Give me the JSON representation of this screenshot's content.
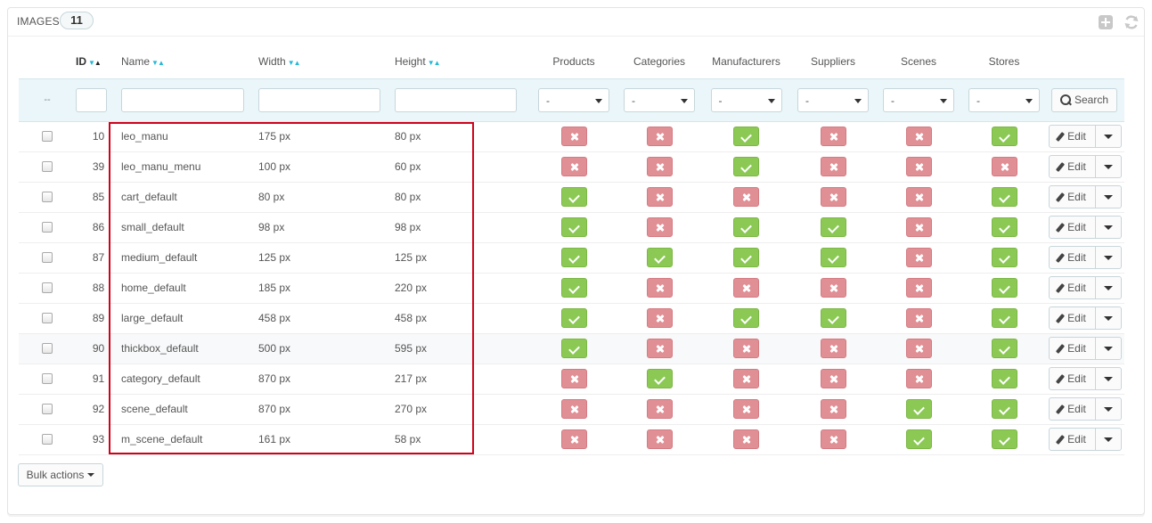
{
  "panel": {
    "title": "IMAGES",
    "count": "11",
    "tools": [
      "add-icon",
      "refresh-icon"
    ]
  },
  "columns": {
    "id": "ID",
    "name": "Name",
    "width": "Width",
    "height": "Height",
    "products": "Products",
    "categories": "Categories",
    "manufacturers": "Manufacturers",
    "suppliers": "Suppliers",
    "scenes": "Scenes",
    "stores": "Stores"
  },
  "filters": {
    "dashes": "--",
    "select_value": "-",
    "search_label": "Search"
  },
  "rows": [
    {
      "id": "10",
      "name": "leo_manu",
      "width": "175 px",
      "height": "80 px",
      "products": false,
      "categories": false,
      "manufacturers": true,
      "suppliers": false,
      "scenes": false,
      "stores": true
    },
    {
      "id": "39",
      "name": "leo_manu_menu",
      "width": "100 px",
      "height": "60 px",
      "products": false,
      "categories": false,
      "manufacturers": true,
      "suppliers": false,
      "scenes": false,
      "stores": false
    },
    {
      "id": "85",
      "name": "cart_default",
      "width": "80 px",
      "height": "80 px",
      "products": true,
      "categories": false,
      "manufacturers": false,
      "suppliers": false,
      "scenes": false,
      "stores": true
    },
    {
      "id": "86",
      "name": "small_default",
      "width": "98 px",
      "height": "98 px",
      "products": true,
      "categories": false,
      "manufacturers": true,
      "suppliers": true,
      "scenes": false,
      "stores": true
    },
    {
      "id": "87",
      "name": "medium_default",
      "width": "125 px",
      "height": "125 px",
      "products": true,
      "categories": true,
      "manufacturers": true,
      "suppliers": true,
      "scenes": false,
      "stores": true
    },
    {
      "id": "88",
      "name": "home_default",
      "width": "185 px",
      "height": "220 px",
      "products": true,
      "categories": false,
      "manufacturers": false,
      "suppliers": false,
      "scenes": false,
      "stores": true
    },
    {
      "id": "89",
      "name": "large_default",
      "width": "458 px",
      "height": "458 px",
      "products": true,
      "categories": false,
      "manufacturers": true,
      "suppliers": true,
      "scenes": false,
      "stores": true
    },
    {
      "id": "90",
      "name": "thickbox_default",
      "width": "500 px",
      "height": "595 px",
      "products": true,
      "categories": false,
      "manufacturers": false,
      "suppliers": false,
      "scenes": false,
      "stores": true
    },
    {
      "id": "91",
      "name": "category_default",
      "width": "870 px",
      "height": "217 px",
      "products": false,
      "categories": true,
      "manufacturers": false,
      "suppliers": false,
      "scenes": false,
      "stores": true
    },
    {
      "id": "92",
      "name": "scene_default",
      "width": "870 px",
      "height": "270 px",
      "products": false,
      "categories": false,
      "manufacturers": false,
      "suppliers": false,
      "scenes": true,
      "stores": true
    },
    {
      "id": "93",
      "name": "m_scene_default",
      "width": "161 px",
      "height": "58 px",
      "products": false,
      "categories": false,
      "manufacturers": false,
      "suppliers": false,
      "scenes": true,
      "stores": true
    }
  ],
  "row_actions": {
    "edit_label": "Edit",
    "edit_icon": "pencil-icon",
    "menu_icon": "caret-down-icon"
  },
  "footer": {
    "bulk_label": "Bulk actions"
  },
  "colors": {
    "enabled": "#8bc954",
    "disabled": "#e08f95",
    "sort_accent": "#25b9d7",
    "highlight_box": "#d0021b"
  }
}
